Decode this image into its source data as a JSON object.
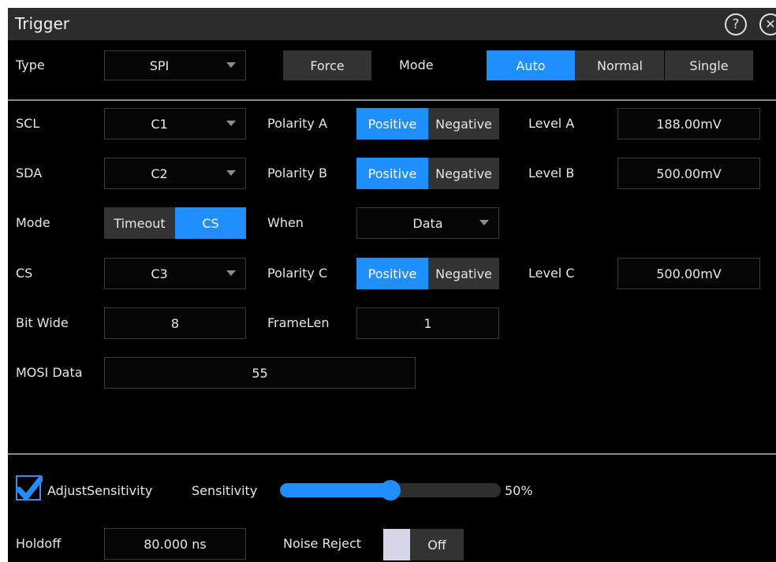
{
  "window": {
    "title": "Trigger"
  },
  "top": {
    "type_label": "Type",
    "type_value": "SPI",
    "force_label": "Force",
    "mode_label": "Mode",
    "mode_options": [
      "Auto",
      "Normal",
      "Single"
    ],
    "mode_selected": "Auto"
  },
  "rows": {
    "scl": {
      "label": "SCL",
      "source": "C1",
      "polarity_label": "Polarity A",
      "polarity_options": [
        "Positive",
        "Negative"
      ],
      "polarity_selected": "Positive",
      "level_label": "Level A",
      "level_value": "188.00mV"
    },
    "sda": {
      "label": "SDA",
      "source": "C2",
      "polarity_label": "Polarity B",
      "polarity_options": [
        "Positive",
        "Negative"
      ],
      "polarity_selected": "Positive",
      "level_label": "Level B",
      "level_value": "500.00mV"
    },
    "mode": {
      "label": "Mode",
      "options": [
        "Timeout",
        "CS"
      ],
      "selected": "CS",
      "when_label": "When",
      "when_value": "Data"
    },
    "cs": {
      "label": "CS",
      "source": "C3",
      "polarity_label": "Polarity C",
      "polarity_options": [
        "Positive",
        "Negative"
      ],
      "polarity_selected": "Positive",
      "level_label": "Level C",
      "level_value": "500.00mV"
    },
    "bitwide": {
      "label": "Bit Wide",
      "value": "8",
      "framelen_label": "FrameLen",
      "framelen_value": "1"
    },
    "mosi": {
      "label": "MOSI Data",
      "value": "55"
    }
  },
  "bottom": {
    "adjust_label": "AdjustSensitivity",
    "adjust_checked": true,
    "sensitivity_label": "Sensitivity",
    "sensitivity_value": 0.5,
    "sensitivity_text": "50%",
    "holdoff_label": "Holdoff",
    "holdoff_value": "80.000 ns",
    "noise_label": "Noise Reject",
    "noise_value": "Off"
  },
  "colors": {
    "accent": "#1f8fff",
    "panel": "#000000",
    "titlebar": "#2c2c2c",
    "button": "#333333"
  },
  "icons": {
    "help": "help-circle-icon",
    "close": "close-circle-icon",
    "dropdown": "caret-down-icon",
    "check": "checkmark-icon"
  }
}
